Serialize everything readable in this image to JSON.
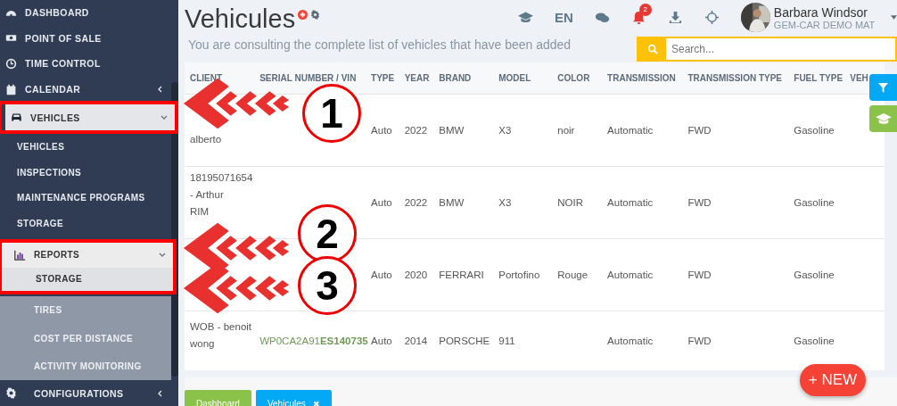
{
  "sidebar": {
    "items": [
      {
        "label": "DASHBOARD",
        "selected": false
      },
      {
        "label": "POINT OF SALE",
        "selected": false
      },
      {
        "label": "TIME CONTROL",
        "selected": false
      },
      {
        "label": "CALENDAR",
        "selected": false,
        "expanded": false
      },
      {
        "label": "VEHICLES",
        "selected": true,
        "expanded": true,
        "framed": true,
        "children": [
          {
            "label": "VEHICLES",
            "selected": false
          },
          {
            "label": "INSPECTIONS",
            "selected": false
          },
          {
            "label": "MAINTENANCE PROGRAMS",
            "selected": false
          },
          {
            "label": "STORAGE",
            "selected": false
          },
          {
            "label": "REPORTS",
            "selected": true,
            "expanded": true,
            "framed": true,
            "children": [
              {
                "label": "STORAGE",
                "selected": true
              },
              {
                "label": "TIRES",
                "selected": false
              },
              {
                "label": "COST PER DISTANCE",
                "selected": false
              },
              {
                "label": "ACTIVITY MONITORING",
                "selected": false
              }
            ]
          }
        ]
      },
      {
        "label": "CONFIGURATIONS",
        "selected": false,
        "expanded": false
      }
    ]
  },
  "header": {
    "title": "Vehicules",
    "subtitle": "You are consulting the complete list of vehicles that have been added",
    "language": "EN",
    "notifications": "2",
    "user": {
      "name": "Barbara Windsor",
      "company": "GEM-CAR DEMO MAT"
    }
  },
  "search": {
    "placeholder": "Search..."
  },
  "table": {
    "columns": [
      "CLIENT",
      "SERIAL NUMBER / VIN",
      "TYPE",
      "YEAR",
      "BRAND",
      "MODEL",
      "COLOR",
      "TRANSMISSION",
      "TRANSMISSION TYPE",
      "FUEL TYPE",
      "VEH"
    ],
    "rows": [
      {
        "client": [
          "alberto"
        ],
        "type": "Auto",
        "year": "2022",
        "brand": "BMW",
        "model": "X3",
        "paint": "noir",
        "transmission": "Automatic",
        "transmission_type": "FWD",
        "fuel": "Gasoline"
      },
      {
        "client": [
          "18195071654",
          "- Arthur",
          "RIM"
        ],
        "type": "Auto",
        "year": "2022",
        "brand": "BMW",
        "model": "X3",
        "paint": "NOIR",
        "transmission": "Automatic",
        "transmission_type": "FWD",
        "fuel": "Gasoline"
      },
      {
        "type": "Auto",
        "year": "2020",
        "brand": "FERRARI",
        "model": "Portofino",
        "paint": "Rouge",
        "transmission": "Automatic",
        "transmission_type": "FWD",
        "fuel": "Gasoline"
      },
      {
        "client": [
          "WOB - benoit",
          "wong"
        ],
        "vin": "WP0CA2A91**ES140735**",
        "type": "Auto",
        "year": "2014",
        "brand": "PORSCHE",
        "model": "911",
        "transmission": "Automatic",
        "transmission_type": "FWD",
        "fuel": "Gasoline"
      }
    ]
  },
  "new_button": "+ NEW",
  "bottom_tabs": [
    {
      "label": "Dashboard",
      "kind": "home"
    },
    {
      "label": "Vehicules",
      "kind": "closable",
      "close": "✖"
    }
  ],
  "annotations": [
    {
      "number": "1"
    },
    {
      "number": "2"
    },
    {
      "number": "3"
    }
  ]
}
